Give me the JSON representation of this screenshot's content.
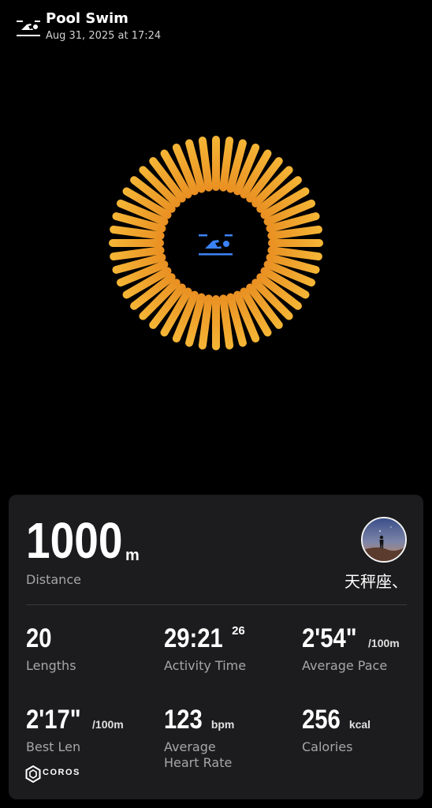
{
  "header": {
    "title": "Pool Swim",
    "datetime": "Aug 31, 2025 at 17:24",
    "icon": "swimmer-icon"
  },
  "activity_graphic": {
    "center_icon": "swimmer-icon",
    "center_icon_color": "#3b82f6",
    "ring_color_outer": "#f5b636",
    "ring_color_inner": "#dd6a0f"
  },
  "summary": {
    "distance_value": "1000",
    "distance_unit": "m",
    "distance_label": "Distance",
    "user_name": "天秤座、",
    "avatar": "user-avatar"
  },
  "stats": [
    {
      "value": "20",
      "unit": "",
      "sup": "",
      "label": "Lengths"
    },
    {
      "value": "29:21",
      "unit": "",
      "sup": "26",
      "label": "Activity Time"
    },
    {
      "value": "2'54\"",
      "unit": "/100m",
      "sup": "",
      "label": "Average Pace"
    },
    {
      "value": "2'17\"",
      "unit": "/100m",
      "sup": "",
      "label": "Best Len"
    },
    {
      "value": "123",
      "unit": "bpm",
      "sup": "",
      "label": "Average Heart Rate"
    },
    {
      "value": "256",
      "unit": "kcal",
      "sup": "",
      "label": "Calories"
    }
  ],
  "brand": {
    "logo_text": "COROS"
  }
}
